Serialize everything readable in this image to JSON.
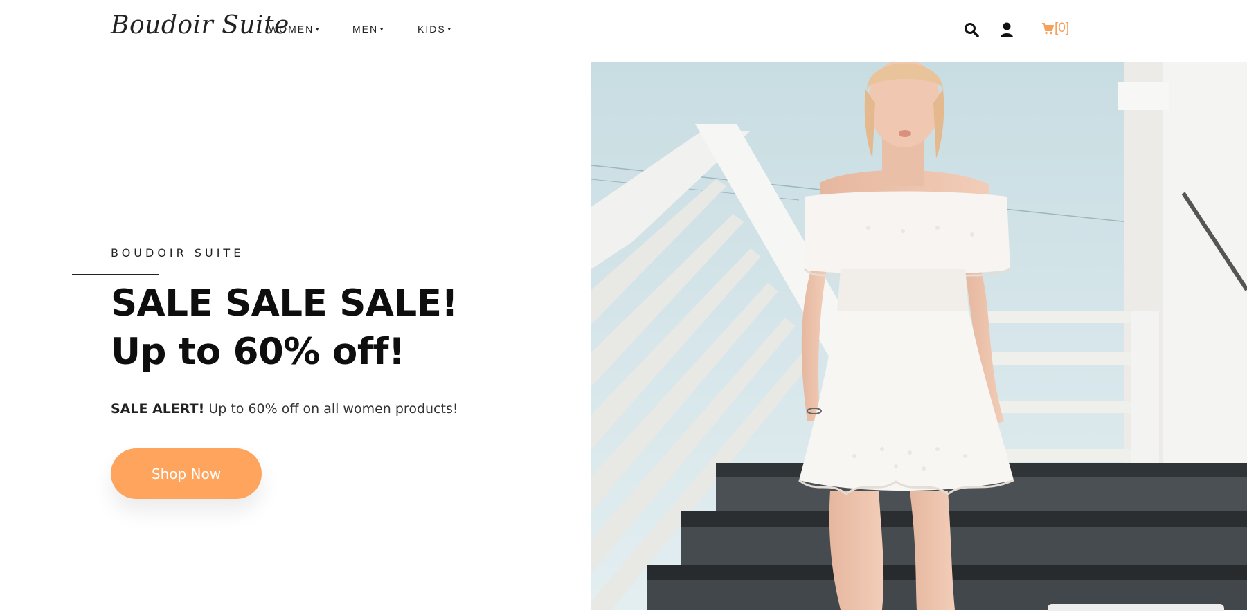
{
  "header": {
    "logo": "Boudoir Suite",
    "nav": [
      {
        "label": "WOMEN",
        "caret": "▾"
      },
      {
        "label": "MEN",
        "caret": "▾"
      },
      {
        "label": "KIDS",
        "caret": "▾"
      }
    ],
    "cart_count": "[0]"
  },
  "hero": {
    "eyebrow": "BOUDOIR SUITE",
    "headline_line1": "SALE SALE SALE!",
    "headline_line2": "Up to 60% off!",
    "sub_bold": "SALE ALERT!",
    "sub_text": " Up to 60% off on all women products!",
    "cta_label": "Shop Now"
  },
  "colors": {
    "accent": "#ffa45c",
    "cart": "#f5a05b",
    "text": "#0e0e0e"
  },
  "icons": [
    "search-icon",
    "user-icon",
    "cart-icon",
    "caret-down-icon"
  ]
}
